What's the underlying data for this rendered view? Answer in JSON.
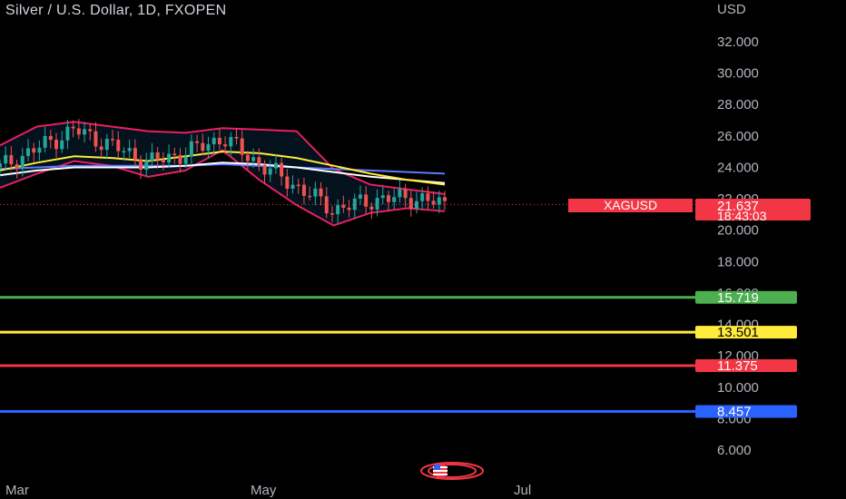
{
  "header": {
    "title": "Silver / U.S. Dollar, 1D, FXOPEN",
    "currency": "USD"
  },
  "symbol_tag": "XAGUSD",
  "last_price": {
    "value": "21.637",
    "countdown": "18:43:03",
    "color": "#f23645"
  },
  "horizontal_lines": [
    {
      "label": "15.719",
      "value": 15.719,
      "color": "#4caf50"
    },
    {
      "label": "13.501",
      "value": 13.501,
      "color": "#ffeb3b"
    },
    {
      "label": "11.375",
      "value": 11.375,
      "color": "#f23645"
    },
    {
      "label": "8.457",
      "value": 8.457,
      "color": "#2962ff"
    }
  ],
  "chart_data": {
    "type": "line",
    "title": "Silver / U.S. Dollar, 1D, FXOPEN",
    "y_axis": {
      "label": "USD",
      "ticks": [
        32,
        30,
        28,
        26,
        24,
        22,
        20,
        18,
        16,
        14,
        12,
        10,
        8,
        6
      ],
      "tick_labels": [
        "32.000",
        "30.000",
        "28.000",
        "26.000",
        "24.000",
        "22.000",
        "20.000",
        "18.000",
        "16.000",
        "14.000",
        "12.000",
        "10.000",
        "8.000",
        "6.000"
      ],
      "range": [
        4.5,
        34.5
      ]
    },
    "x_axis": {
      "tick_labels": [
        "Mar",
        "May",
        "Jul"
      ]
    },
    "series": [
      {
        "type": "candlestick",
        "x": [
          "2023-02-20",
          "2023-03-01",
          "2023-03-10",
          "2023-03-20",
          "2023-03-31",
          "2023-04-10",
          "2023-04-20",
          "2023-05-01",
          "2023-05-10",
          "2023-05-20",
          "2023-05-30",
          "2023-06-10",
          "2023-06-20"
        ],
        "close": [
          24.0,
          25.2,
          26.4,
          25.4,
          24.3,
          24.9,
          25.9,
          24.2,
          22.8,
          21.3,
          21.9,
          22.1,
          21.637
        ]
      },
      {
        "type": "bollinger_upper",
        "values": [
          25.4,
          26.6,
          26.9,
          26.6,
          26.3,
          26.2,
          26.5,
          26.4,
          26.3,
          23.9,
          22.9,
          22.6,
          22.3
        ]
      },
      {
        "type": "bollinger_lower",
        "values": [
          22.7,
          23.6,
          24.4,
          24.1,
          23.4,
          23.8,
          25.1,
          23.2,
          21.6,
          20.3,
          21.1,
          21.4,
          21.2
        ]
      },
      {
        "type": "ma_yellow",
        "values": [
          23.8,
          24.3,
          24.7,
          24.6,
          24.4,
          24.7,
          25.0,
          24.9,
          24.6,
          24.1,
          23.6,
          23.2,
          22.9
        ]
      },
      {
        "type": "ma_white",
        "values": [
          23.5,
          23.8,
          24.0,
          24.0,
          24.0,
          24.1,
          24.3,
          24.2,
          24.0,
          23.7,
          23.4,
          23.2,
          23.0
        ]
      },
      {
        "type": "ma_blue",
        "values": [
          23.9,
          24.0,
          24.1,
          24.1,
          24.1,
          24.1,
          24.2,
          24.1,
          24.0,
          23.9,
          23.8,
          23.7,
          23.6
        ]
      }
    ]
  }
}
